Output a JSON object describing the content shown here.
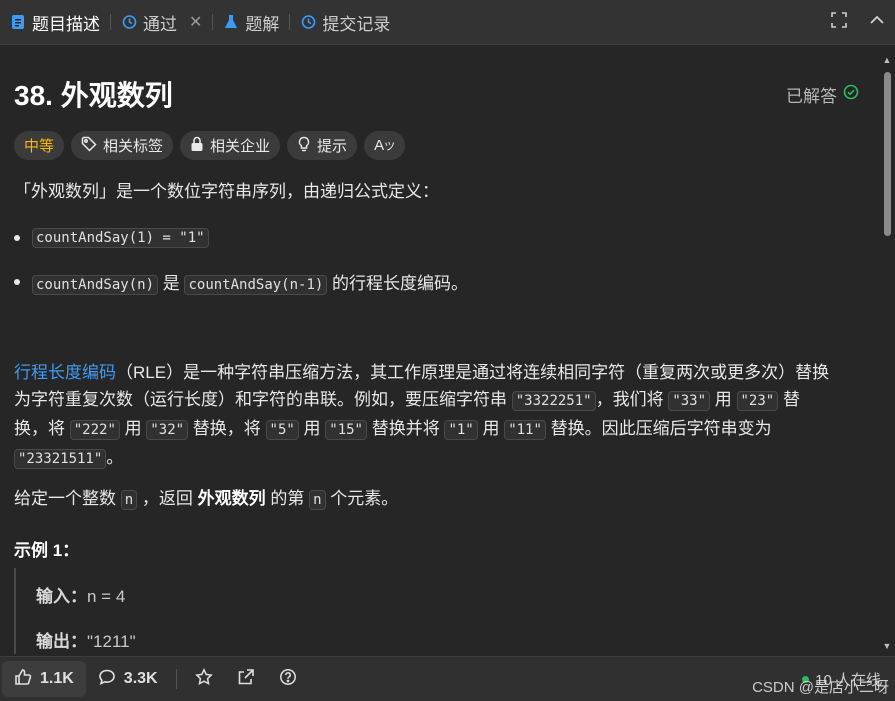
{
  "tabs": [
    {
      "label": "题目描述",
      "icon": "document-icon",
      "active": true
    },
    {
      "label": "通过",
      "icon": "history-icon",
      "closable": true
    },
    {
      "label": "题解",
      "icon": "flask-icon"
    },
    {
      "label": "提交记录",
      "icon": "history-icon"
    }
  ],
  "tab_close": "✕",
  "problem": {
    "title": "38. 外观数列",
    "status": "已解答",
    "difficulty": "中等",
    "tags": [
      "相关标签",
      "相关企业",
      "提示"
    ]
  },
  "desc": {
    "intro": "「外观数列」是一个数位字符串序列，由递归公式定义：",
    "b1_code": "countAndSay(1) = \"1\"",
    "b2_code1": "countAndSay(n)",
    "b2_mid": " 是 ",
    "b2_code2": "countAndSay(n-1)",
    "b2_tail": " 的行程长度编码。",
    "rle_link": "行程长度编码",
    "rle_l1": "（RLE）是一种字符串压缩方法，其工作原理是通过将连续相同字符（重复两次或更多次）替换",
    "rle_l2a": "为字符重复次数（运行长度）和字符的串联。例如，要压缩字符串 ",
    "c1": "\"3322251\"",
    "rle_l2b": "，我们将 ",
    "c2": "\"33\"",
    "yong": " 用 ",
    "c3": "\"23\"",
    "ti": " 替",
    "huan_jiang": "换，将 ",
    "c4": "\"222\"",
    "c5": "\"32\"",
    "tihuan_jiang": " 替换，将 ",
    "c6": "\"5\"",
    "c7": "\"15\"",
    "tihuan_bingjiang": " 替换并将 ",
    "c8": "\"1\"",
    "c9": "\"11\"",
    "tihuan_tail": " 替换。因此压缩后字符串变为",
    "c10": "\"23321511\"",
    "period": "。",
    "given_a": "给定一个整数 ",
    "given_n": "n",
    "given_b": " ，返回 ",
    "given_bold": "外观数列",
    "given_c": " 的第 ",
    "given_d": " 个元素。"
  },
  "example": {
    "title": "示例 1：",
    "input_label": "输入：",
    "input_value": "n = 4",
    "output_label": "输出：",
    "output_value": "\"1211\""
  },
  "bottom": {
    "likes": "1.1K",
    "comments": "3.3K",
    "online": "10 人在线"
  },
  "watermark": "CSDN @是店小二呀",
  "colors": {
    "accent": "#3c9cf5",
    "medium": "#ffb800",
    "solved": "#2cbb5d"
  }
}
